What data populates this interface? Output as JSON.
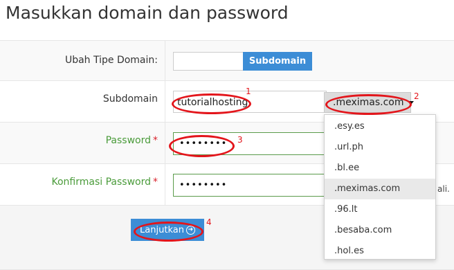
{
  "page": {
    "title": "Masukkan domain dan password"
  },
  "domain_type": {
    "label": "Ubah Tipe Domain:",
    "button": "Subdomain"
  },
  "subdomain": {
    "label": "Subdomain",
    "value": "tutorialhosting",
    "selected_tld": ".meximas.com",
    "options": [
      ".esy.es",
      ".url.ph",
      ".bl.ee",
      ".meximas.com",
      ".96.lt",
      ".besaba.com",
      ".hol.es"
    ],
    "highlighted_index": 3
  },
  "password": {
    "label": "Password",
    "required_mark": "*",
    "value": "••••••••"
  },
  "confirm": {
    "label": "Konfirmasi Password",
    "required_mark": "*",
    "value": "••••••••",
    "trailing_text": "ali."
  },
  "submit": {
    "label": "Lanjutkan"
  },
  "annotations": {
    "n1": "1",
    "n2": "2",
    "n3": "3",
    "n4": "4"
  },
  "colors": {
    "primary": "#3c8dd6",
    "annotation": "#e3151b",
    "label_green": "#4a9b3a",
    "required": "#d9232d"
  },
  "icons": {
    "select_caret": "caret-down-icon",
    "submit_arrow": "arrow-right-circle-icon"
  }
}
